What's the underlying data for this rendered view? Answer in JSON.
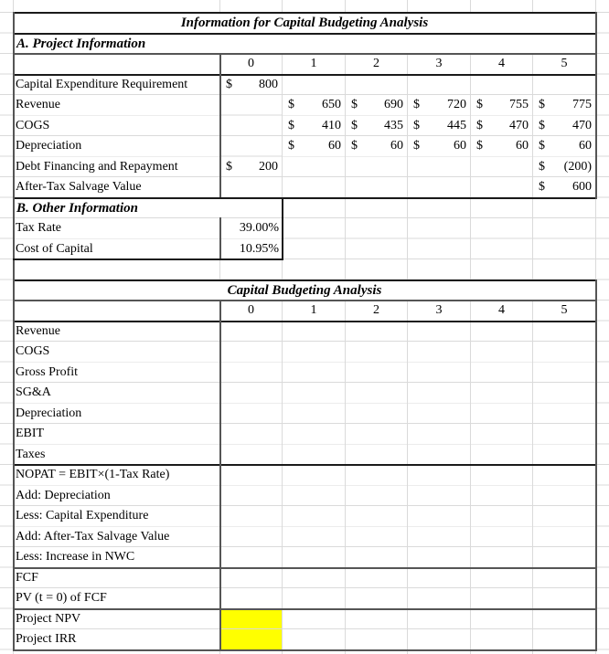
{
  "sheet": {
    "title": "Information for Capital Budgeting Analysis",
    "section_a": {
      "heading": "A. Project Information",
      "periods": [
        "0",
        "1",
        "2",
        "3",
        "4",
        "5"
      ],
      "rows": [
        {
          "label": "Capital Expenditure Requirement",
          "values": [
            [
              "$",
              "800"
            ],
            null,
            null,
            null,
            null,
            null
          ]
        },
        {
          "label": "Revenue",
          "values": [
            null,
            [
              "$",
              "650"
            ],
            [
              "$",
              "690"
            ],
            [
              "$",
              "720"
            ],
            [
              "$",
              "755"
            ],
            [
              "$",
              "775"
            ]
          ]
        },
        {
          "label": "COGS",
          "values": [
            null,
            [
              "$",
              "410"
            ],
            [
              "$",
              "435"
            ],
            [
              "$",
              "445"
            ],
            [
              "$",
              "470"
            ],
            [
              "$",
              "470"
            ]
          ]
        },
        {
          "label": "Depreciation",
          "values": [
            null,
            [
              "$",
              "60"
            ],
            [
              "$",
              "60"
            ],
            [
              "$",
              "60"
            ],
            [
              "$",
              "60"
            ],
            [
              "$",
              "60"
            ]
          ]
        },
        {
          "label": "Debt Financing and Repayment",
          "values": [
            [
              "$",
              "200"
            ],
            null,
            null,
            null,
            null,
            [
              "$",
              "(200)"
            ]
          ]
        },
        {
          "label": "After-Tax Salvage Value",
          "values": [
            null,
            null,
            null,
            null,
            null,
            [
              "$",
              "600"
            ]
          ]
        }
      ]
    },
    "section_b": {
      "heading": "B. Other Information",
      "rows": [
        {
          "label": "Tax Rate",
          "value": "39.00%"
        },
        {
          "label": "Cost of Capital",
          "value": "10.95%"
        }
      ]
    },
    "analysis": {
      "title": "Capital Budgeting Analysis",
      "periods": [
        "0",
        "1",
        "2",
        "3",
        "4",
        "5"
      ],
      "rows": [
        "Revenue",
        "COGS",
        "Gross Profit",
        "SG&A",
        "Depreciation",
        "EBIT",
        "Taxes",
        "NOPAT = EBIT×(1-Tax Rate)",
        "Add: Depreciation",
        "Less: Capital Expenditure",
        "Add:  After-Tax Salvage Value",
        "Less: Increase in NWC",
        "FCF",
        "PV (t = 0) of FCF",
        "Project NPV",
        "Project IRR"
      ],
      "highlight_color": "#ffff00"
    }
  }
}
